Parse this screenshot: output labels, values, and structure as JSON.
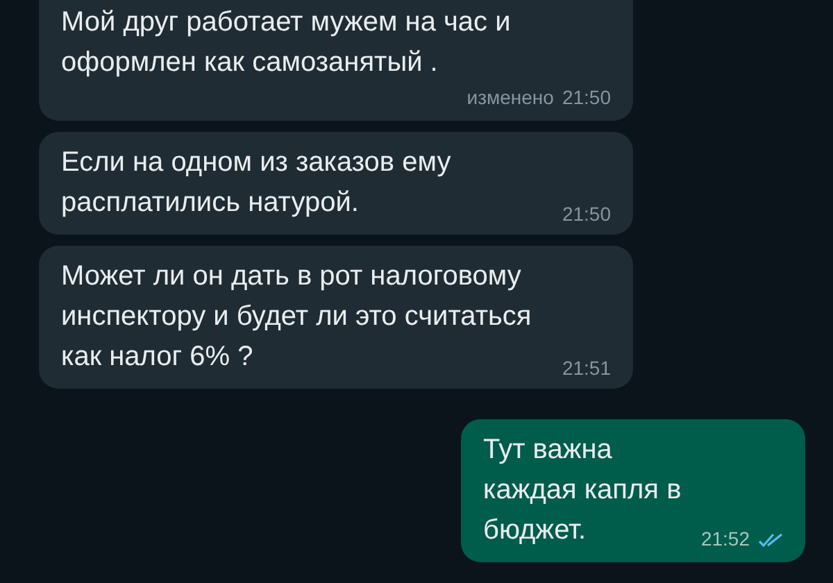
{
  "messages": [
    {
      "kind": "incoming",
      "text": "Мой друг работает мужем на час и оформлен как самозанятый .",
      "edited": "изменено",
      "time": "21:50"
    },
    {
      "kind": "incoming",
      "text": "Если на одном из заказов ему расплатились натурой.",
      "time": "21:50"
    },
    {
      "kind": "incoming",
      "text": "Может ли он дать в рот налоговому инспектору и будет ли это считаться как налог 6% ?",
      "time": "21:51"
    },
    {
      "kind": "outgoing",
      "text": "Тут важна каждая капля в бюджет.",
      "time": "21:52",
      "read": true
    }
  ]
}
